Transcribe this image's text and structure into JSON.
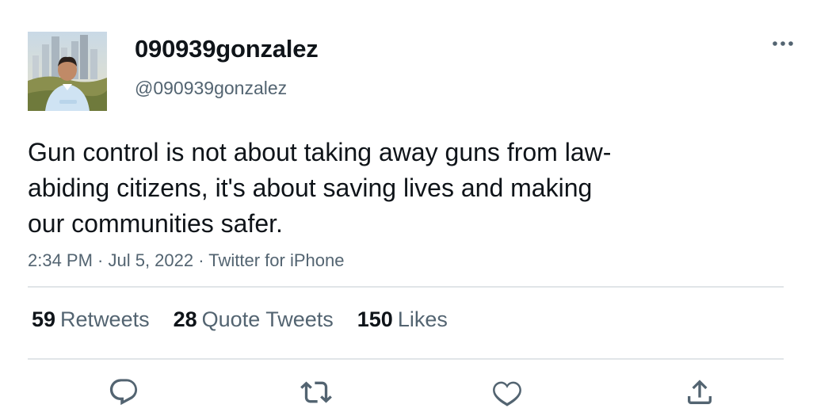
{
  "tweet": {
    "display_name": "090939gonzalez",
    "handle": "@090939gonzalez",
    "text": "Gun control is not about taking away guns from law-\nabiding citizens, it's about saving lives and making\nour communities safer.",
    "meta": "2:34 PM · Jul 5, 2022 · Twitter for iPhone"
  },
  "stats": [
    {
      "count": "59",
      "label": "Retweets"
    },
    {
      "count": "28",
      "label": "Quote Tweets"
    },
    {
      "count": "150",
      "label": "Likes"
    }
  ],
  "icons": {
    "more": "more-horizontal-icon",
    "reply": "reply-icon",
    "retweet": "retweet-icon",
    "like": "heart-icon",
    "share": "share-icon"
  },
  "colors": {
    "text_primary": "#0f1419",
    "text_secondary": "#536471",
    "divider": "#e1e5e8"
  }
}
